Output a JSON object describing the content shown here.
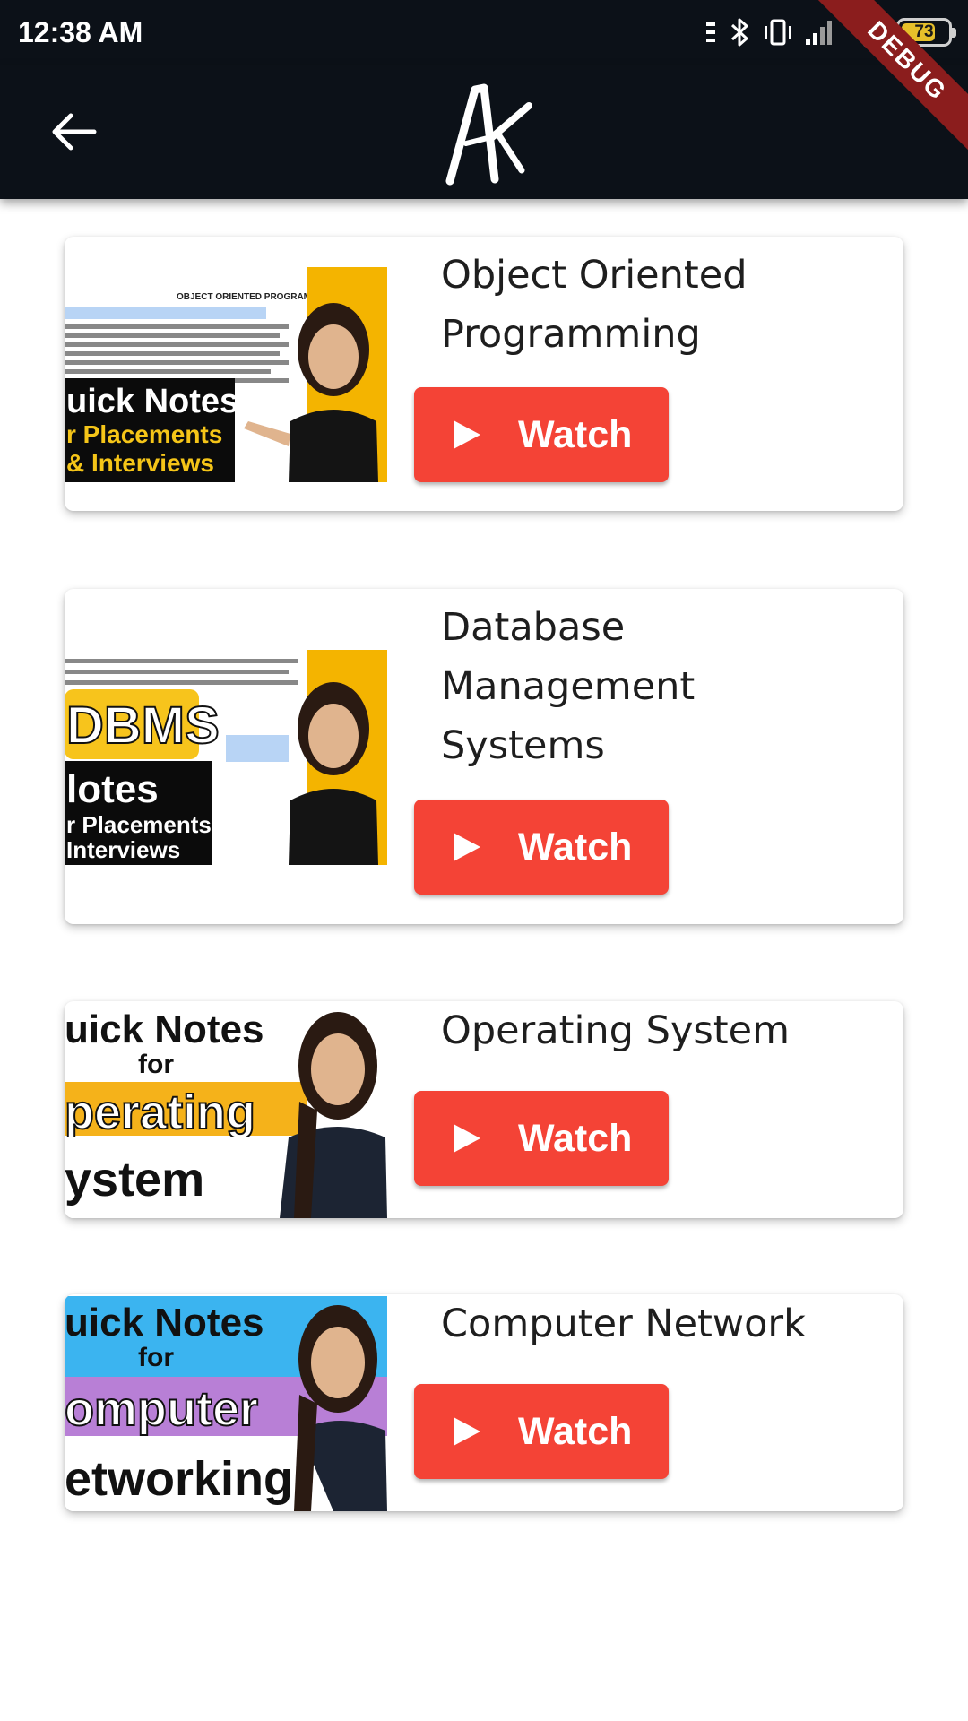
{
  "status_bar": {
    "time": "12:38 AM",
    "battery_level": "73",
    "battery_fraction": 0.73,
    "icons": [
      "menu-dots-icon",
      "bluetooth-icon",
      "vibrate-icon",
      "signal-icon",
      "wifi-icon",
      "battery-icon"
    ]
  },
  "app_bar": {
    "back_icon": "arrow-left-icon",
    "logo_icon": "ak-logo-icon",
    "ribbon": "DEBUG"
  },
  "colors": {
    "app_bar_bg": "#0c1118",
    "watch_button": "#f44336",
    "title_text": "#1e1e1e",
    "debug_ribbon": "#8b1d1d"
  },
  "courses": [
    {
      "title": "Object Oriented\nProgramming",
      "button_label": "Watch",
      "thumbnail": {
        "heading": "OBJECT ORIENTED PROGRAMMING",
        "overlay_lines": [
          "uick Notes",
          "r Placements",
          "& Interviews"
        ]
      }
    },
    {
      "title": "Database\nManagement\nSystems",
      "button_label": "Watch",
      "thumbnail": {
        "overlay_lines": [
          "DBMS",
          "lotes",
          "r Placements",
          "Interviews"
        ]
      }
    },
    {
      "title": "Operating System",
      "button_label": "Watch",
      "thumbnail": {
        "overlay_lines": [
          "uick Notes",
          "for",
          "perating",
          "ystem"
        ]
      }
    },
    {
      "title": "Computer Network",
      "button_label": "Watch",
      "thumbnail": {
        "overlay_lines": [
          "uick Notes",
          "for",
          "omputer",
          "etworking"
        ]
      }
    }
  ]
}
